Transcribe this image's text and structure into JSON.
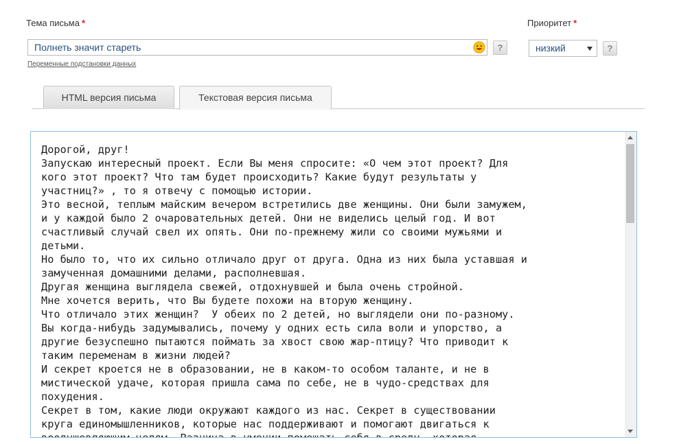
{
  "subject": {
    "label": "Тема письма",
    "required_mark": "*",
    "value": "Полнеть значит стареть",
    "emoji_icon": "smiley-icon",
    "help_label": "?"
  },
  "priority": {
    "label": "Приоритет",
    "required_mark": "*",
    "selected": "низкий",
    "help_label": "?"
  },
  "variables_link": "Переменные подстановки данных",
  "tabs": [
    {
      "label": "HTML версия письма",
      "active": false
    },
    {
      "label": "Текстовая версия письма",
      "active": true
    }
  ],
  "body_lines": [
    "Дорогой, друг!",
    "Запускаю интересный проект. Если Вы меня спросите: «О чем этот проект? Для",
    "кого этот проект? Что там будет происходить? Какие будут результаты у",
    "участниц?» , то я отвечу с помощью истории.",
    "Это весной, теплым майским вечером встретились две женщины. Они были замужем,",
    "и у каждой было 2 очаровательных детей. Они не виделись целый год. И вот",
    "счастливый случай свел их опять. Они по-прежнему жили со своими мужьями и",
    "детьми.",
    "Но было то, что их сильно отличало друг от друга. Одна из них была уставшая и",
    "замученная домашними делами, располневшая.",
    "Другая женщина выглядела свежей, отдохнувшей и была очень стройной.",
    "Мне хочется верить, что Вы будете похожи на вторую женщину.",
    "Что отличало этих женщин?  У обеих по 2 детей, но выглядели они по-разному.",
    "Вы когда-нибудь задумывались, почему у одних есть сила воли и упорство, а",
    "другие безуспешно пытаются поймать за хвост свою жар-птицу? Что приводит к",
    "таким переменам в жизни людей?",
    "И секрет кроется не в образовании, не в каком-то особом таланте, и не в",
    "мистической удаче, которая пришла сама по себе, не в чудо-средствах для",
    "похудения.",
    "Секрет в том, какие люди окружают каждого из нас. Секрет в существовании",
    "круга единомышленников, которые нас поддерживают и помогают двигаться к",
    "воодушевляющим целям. Разница в умении помещать себя в среду, которая"
  ],
  "colors": {
    "accent_border": "#8fbce6",
    "required": "#d9262b",
    "input_text": "#2b4e80"
  }
}
